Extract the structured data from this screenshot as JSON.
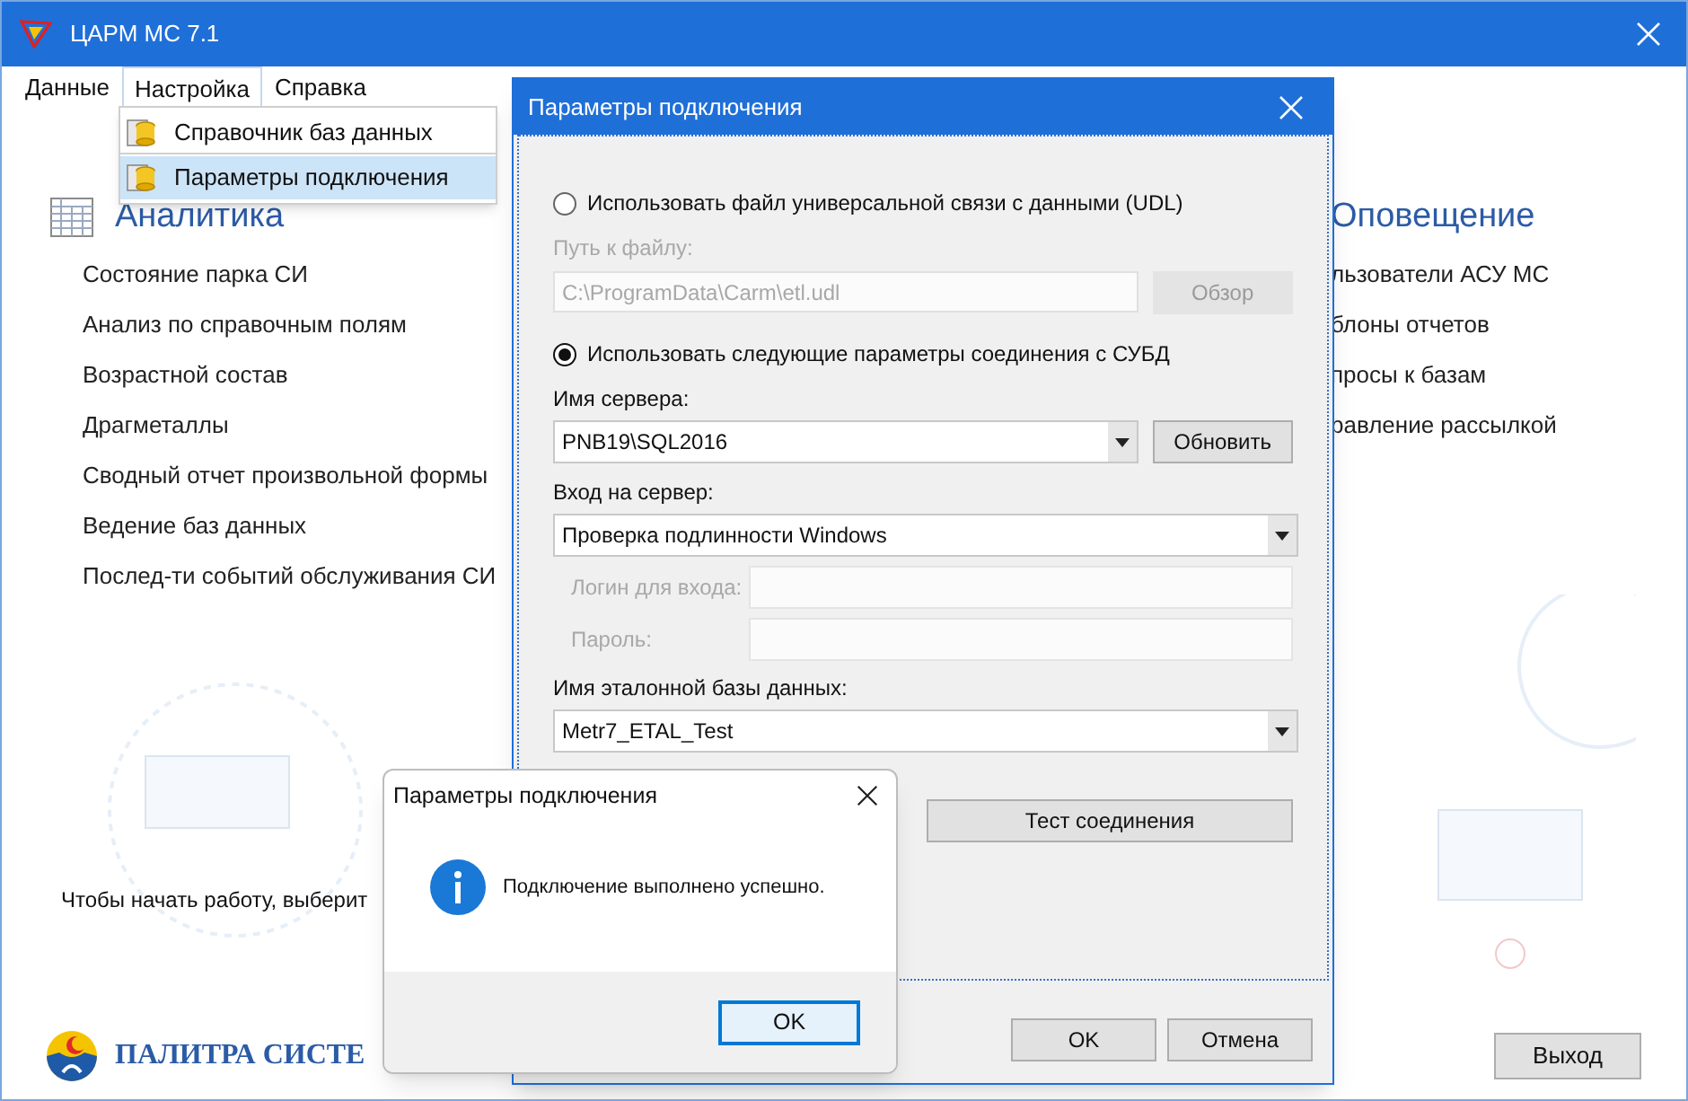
{
  "window": {
    "title": "ЦАРМ МС 7.1"
  },
  "menu": [
    {
      "label": "Данные",
      "selected": false
    },
    {
      "label": "Настройка",
      "selected": true
    },
    {
      "label": "Справка",
      "selected": false
    }
  ],
  "dropdown": [
    {
      "label": "Справочник баз данных",
      "selected": false
    },
    {
      "label": "Параметры подключения",
      "selected": true
    }
  ],
  "analytics": {
    "title": "Аналитика",
    "items": [
      "Состояние парка СИ",
      "Анализ по справочным полям",
      "Возрастной состав",
      "Драгметаллы",
      "Сводный отчет произвольной формы",
      "Ведение баз данных",
      "Послед-ти событий обслуживания СИ"
    ]
  },
  "notifications": {
    "title": "Оповещение",
    "items": [
      "льзователи АСУ МС",
      "блоны отчетов",
      "просы к базам",
      "равление рассылкой"
    ]
  },
  "hint": "Чтобы начать работу, выберит",
  "logo_text": "ПАЛИТРА СИСТЕ",
  "exit_button": "Выход",
  "dialog": {
    "title": "Параметры подключения",
    "options": [
      {
        "label": "Использовать файл универсальной связи с данными (UDL)",
        "selected": false
      },
      {
        "label": "Использовать следующие параметры соединения с СУБД",
        "selected": true
      }
    ],
    "path": {
      "label": "Путь к файлу:",
      "value": "C:\\ProgramData\\Carm\\etl.udl",
      "disabled": true
    },
    "browse_button": "Обзор",
    "server": {
      "label": "Имя сервера:",
      "value": "PNB19\\SQL2016"
    },
    "refresh_button": "Обновить",
    "login_mode": {
      "label": "Вход на сервер:",
      "value": "Проверка подлинности Windows"
    },
    "login": {
      "label": "Логин для входа:",
      "disabled": true
    },
    "password": {
      "label": "Пароль:",
      "disabled": true
    },
    "database": {
      "label": "Имя эталонной базы данных:",
      "value": "Metr7_ETAL_Test"
    },
    "test_button": "Тест соединения",
    "ok_button": "OK",
    "cancel_button": "Отмена"
  },
  "message": {
    "title": "Параметры подключения",
    "text": "Подключение выполнено успешно.",
    "ok_button": "OK"
  }
}
